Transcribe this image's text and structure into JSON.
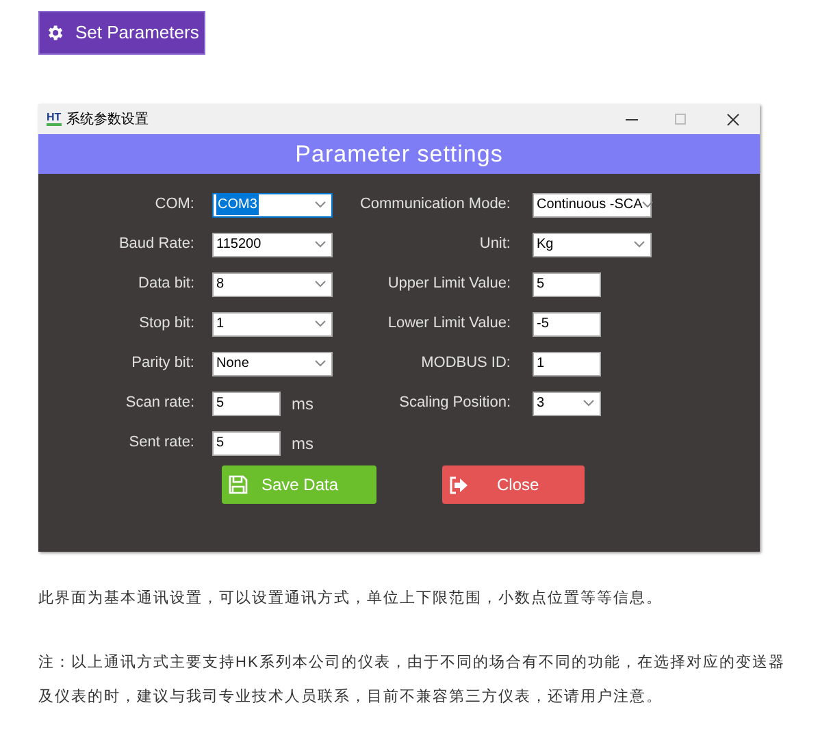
{
  "top_button": {
    "label": "Set Parameters"
  },
  "window": {
    "title": "系统参数设置",
    "app_icon": "HT",
    "header": "Parameter settings"
  },
  "left_fields": [
    {
      "label": "COM:",
      "kind": "select",
      "value": "COM3",
      "selected": true
    },
    {
      "label": "Baud Rate:",
      "kind": "select",
      "value": "115200",
      "selected": false
    },
    {
      "label": "Data bit:",
      "kind": "select",
      "value": "8",
      "selected": false
    },
    {
      "label": "Stop bit:",
      "kind": "select",
      "value": "1",
      "selected": false
    },
    {
      "label": "Parity bit:",
      "kind": "select",
      "value": "None",
      "selected": false
    },
    {
      "label": "Scan rate:",
      "kind": "text",
      "value": "5",
      "unit": "ms",
      "selected": false
    },
    {
      "label": "Sent rate:",
      "kind": "text",
      "value": "5",
      "unit": "ms",
      "selected": false
    }
  ],
  "right_fields": [
    {
      "label": "Communication Mode:",
      "kind": "select",
      "value": "Continuous -SCA",
      "selected": false
    },
    {
      "label": "Unit:",
      "kind": "select",
      "value": "Kg",
      "selected": false
    },
    {
      "label": "Upper Limit Value:",
      "kind": "text",
      "value": "5",
      "selected": false
    },
    {
      "label": "Lower Limit Value:",
      "kind": "text",
      "value": "-5",
      "selected": false
    },
    {
      "label": "MODBUS ID:",
      "kind": "text",
      "value": "1",
      "selected": false
    },
    {
      "label": "Scaling Position:",
      "kind": "short_select",
      "value": "3",
      "selected": false
    }
  ],
  "buttons": [
    {
      "label": "Save Data",
      "kind": "save"
    },
    {
      "label": "Close",
      "kind": "close"
    }
  ],
  "paragraphs": [
    "此界面为基本通讯设置，可以设置通讯方式，单位上下限范围，小数点位置等等信息。",
    "注：以上通讯方式主要支持HK系列本公司的仪表，由于不同的场合有不同的功能，在选择对应的变送器及仪表的时，建议与我司专业技术人员联系，目前不兼容第三方仪表，还请用户注意。"
  ]
}
